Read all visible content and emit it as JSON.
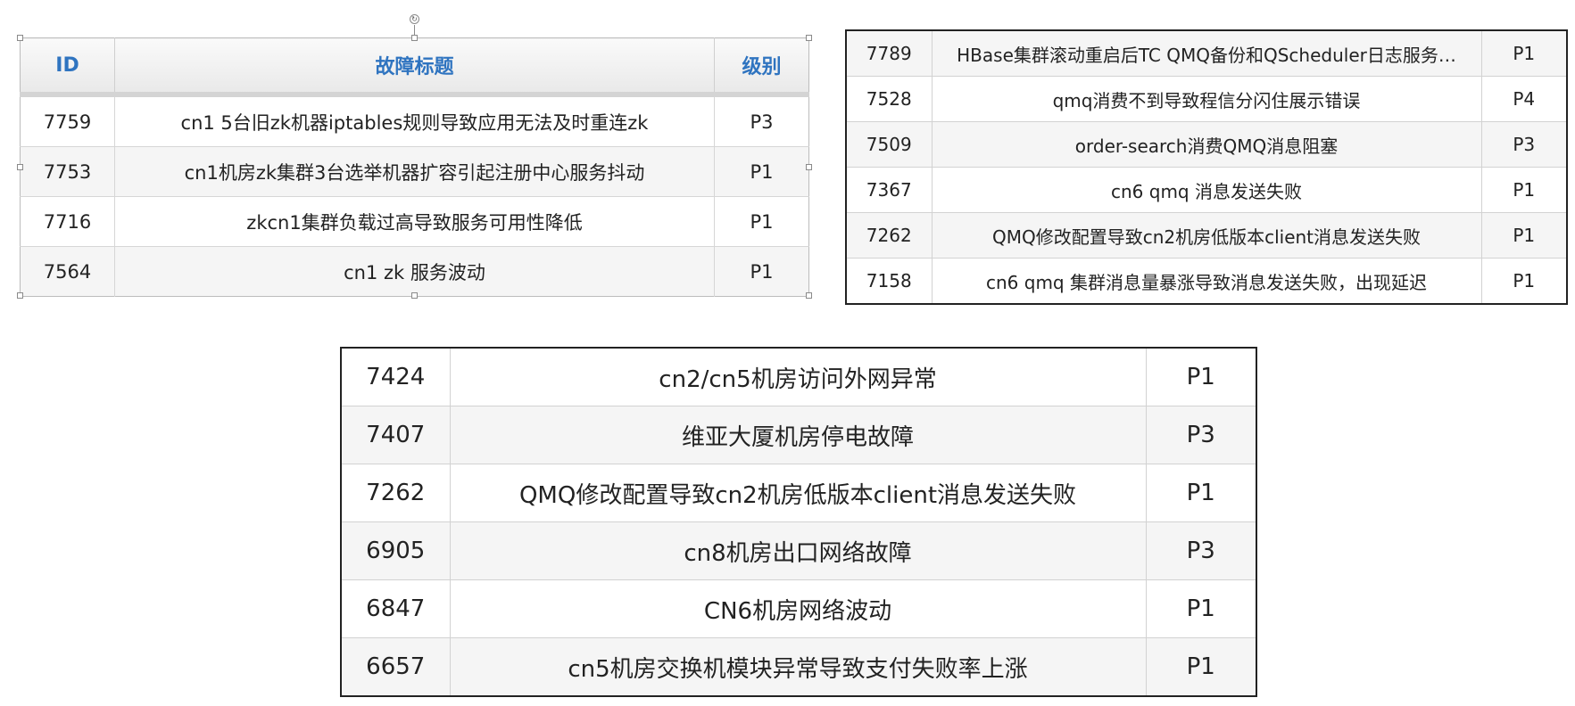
{
  "table1": {
    "headers": [
      "ID",
      "故障标题",
      "级别"
    ],
    "rows": [
      {
        "id": "7759",
        "title": "cn1 5台旧zk机器iptables规则导致应用无法及时重连zk",
        "level": "P3"
      },
      {
        "id": "7753",
        "title": "cn1机房zk集群3台选举机器扩容引起注册中心服务抖动",
        "level": "P1"
      },
      {
        "id": "7716",
        "title": "zkcn1集群负载过高导致服务可用性降低",
        "level": "P1"
      },
      {
        "id": "7564",
        "title": "cn1 zk 服务波动",
        "level": "P1"
      }
    ]
  },
  "table2": {
    "rows": [
      {
        "id": "7789",
        "title": "HBase集群滚动重启后TC QMQ备份和QScheduler日志服务…",
        "level": "P1"
      },
      {
        "id": "7528",
        "title": "qmq消费不到导致程信分闪住展示错误",
        "level": "P4"
      },
      {
        "id": "7509",
        "title": "order-search消费QMQ消息阻塞",
        "level": "P3"
      },
      {
        "id": "7367",
        "title": "cn6 qmq 消息发送失败",
        "level": "P1"
      },
      {
        "id": "7262",
        "title": "QMQ修改配置导致cn2机房低版本client消息发送失败",
        "level": "P1"
      },
      {
        "id": "7158",
        "title": "cn6 qmq 集群消息量暴涨导致消息发送失败，出现延迟",
        "level": "P1"
      }
    ]
  },
  "table3": {
    "rows": [
      {
        "id": "7424",
        "title": "cn2/cn5机房访问外网异常",
        "level": "P1"
      },
      {
        "id": "7407",
        "title": "维亚大厦机房停电故障",
        "level": "P3"
      },
      {
        "id": "7262",
        "title": "QMQ修改配置导致cn2机房低版本client消息发送失败",
        "level": "P1"
      },
      {
        "id": "6905",
        "title": "cn8机房出口网络故障",
        "level": "P3"
      },
      {
        "id": "6847",
        "title": "CN6机房网络波动",
        "level": "P1"
      },
      {
        "id": "6657",
        "title": "cn5机房交换机模块异常导致支付失败率上涨",
        "level": "P1"
      }
    ]
  },
  "colors": {
    "header_text": "#2f74c0",
    "row_alt": "#f5f5f5",
    "border_dark": "#222222"
  },
  "icons": {
    "rotate_handle": "rotate-icon"
  }
}
